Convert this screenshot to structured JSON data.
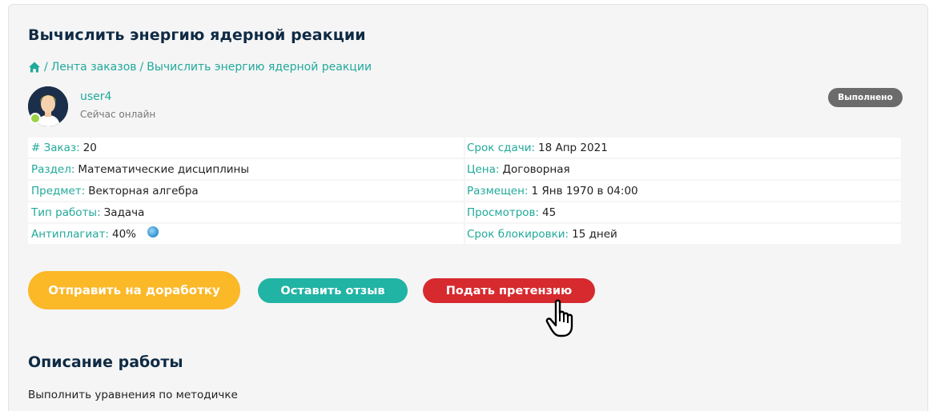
{
  "page": {
    "title": "Вычислить энергию ядерной реакции"
  },
  "breadcrumb": {
    "icon": "home-icon",
    "items": [
      {
        "label": "Лента заказов"
      },
      {
        "label": "Вычислить энергию ядерной реакции"
      }
    ],
    "separator": "/"
  },
  "user": {
    "name": "user4",
    "status": "Сейчас онлайн",
    "online_color": "#9bd246"
  },
  "order_status": "Выполнено",
  "details": {
    "left": [
      {
        "label": "# Заказ:",
        "value": "20"
      },
      {
        "label": "Раздел:",
        "value": "Математические дисциплины"
      },
      {
        "label": "Предмет:",
        "value": "Векторная алгебра"
      },
      {
        "label": "Тип работы:",
        "value": "Задача"
      },
      {
        "label": "Антиплагиат:",
        "value": "40%"
      }
    ],
    "right": [
      {
        "label": "Срок сдачи:",
        "value": "18 Апр 2021"
      },
      {
        "label": "Цена:",
        "value": "Договорная"
      },
      {
        "label": "Размещен:",
        "value": "1 Янв 1970 в 04:00"
      },
      {
        "label": "Просмотров:",
        "value": "45"
      },
      {
        "label": "Срок блокировки:",
        "value": "15 дней"
      }
    ]
  },
  "actions": {
    "rework": "Отправить на доработку",
    "review": "Оставить отзыв",
    "claim": "Подать претензию"
  },
  "description": {
    "title": "Описание работы",
    "text": "Выполнить уравнения по методичке"
  },
  "colors": {
    "accent": "#21a99a",
    "heading": "#0f2a43",
    "rework": "#fbb827",
    "review": "#21b3a3",
    "claim": "#d62a2f",
    "badge": "#6b6b6b"
  }
}
